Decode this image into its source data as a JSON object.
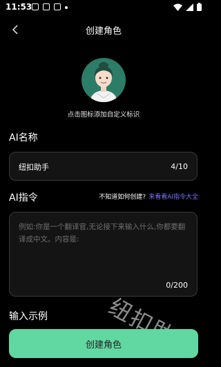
{
  "status_bar": {
    "time": "11:53"
  },
  "header": {
    "title": "创建角色"
  },
  "avatar": {
    "hint": "点击图标添加自定义标识"
  },
  "name_section": {
    "label": "AI名称",
    "value": "纽扣助手",
    "counter": "4/10"
  },
  "command_section": {
    "label": "AI指令",
    "help_question": "不知道如何创建?",
    "help_link": "来看看AI指令大全",
    "placeholder": "例如:你是一个翻译官,无论接下来输入什么,你都要翻译成中文。内容是:",
    "counter": "0/200"
  },
  "example_section": {
    "label": "输入示例"
  },
  "watermark": "纽扣助手",
  "primary_button": {
    "label": "创建角色",
    "color": "#61d7a2"
  },
  "colors": {
    "background": "#000000",
    "accent": "#61d7a2",
    "link": "#7b74ff"
  }
}
